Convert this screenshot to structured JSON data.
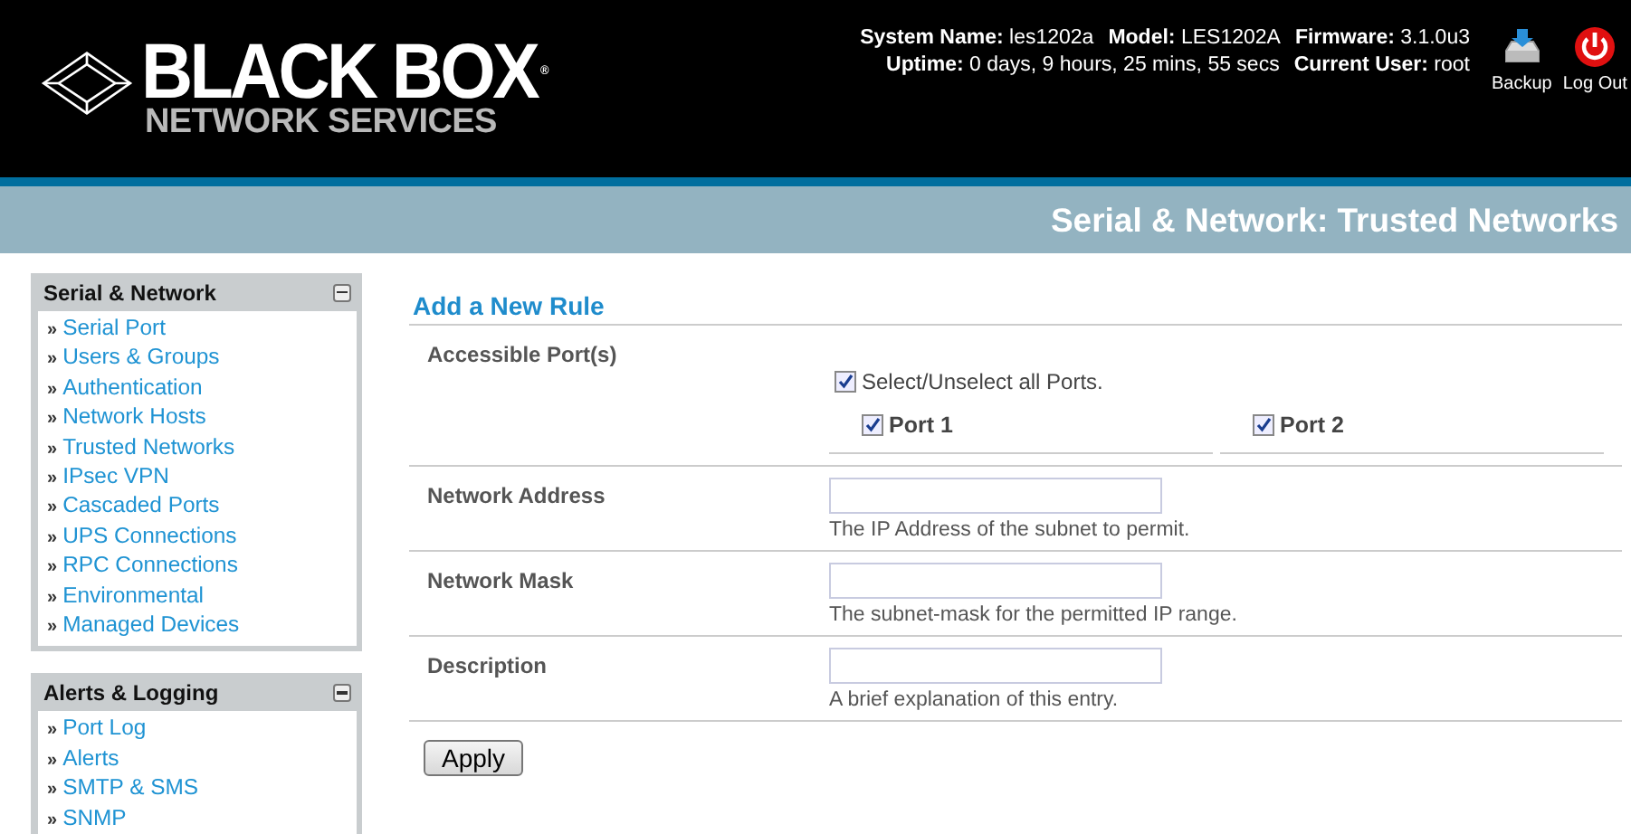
{
  "header": {
    "logo": {
      "title": "BLACK BOX",
      "registered": "®",
      "subtitle": "NETWORK SERVICES"
    },
    "info_lines": [
      [
        "**System Name:** les1202a",
        "**Model:** LES1202A",
        "**Firmware:** 3.1.0u3"
      ],
      [
        "**Uptime:** 0 days, 9 hours, 25 mins, 55 secs",
        "**Current User:** root"
      ]
    ],
    "actions": [
      {
        "kind": "backup",
        "label": "Backup"
      },
      {
        "kind": "logout",
        "label": "Log Out"
      }
    ]
  },
  "page_title": "Serial & Network: Trusted Networks",
  "sidebar": [
    {
      "title": "Serial & Network",
      "expanded": true,
      "items": [
        {
          "marker": "»",
          "label": "Serial Port"
        },
        {
          "marker": "»",
          "label": "Users & Groups"
        },
        {
          "marker": "»",
          "label": "Authentication"
        },
        {
          "marker": "»",
          "label": "Network Hosts"
        },
        {
          "marker": "»",
          "label": "Trusted Networks"
        },
        {
          "marker": "»",
          "label": "IPsec VPN"
        },
        {
          "marker": "»",
          "label": "Cascaded Ports"
        },
        {
          "marker": "»",
          "label": "UPS Connections"
        },
        {
          "marker": "»",
          "label": "RPC Connections"
        },
        {
          "marker": "»",
          "label": "Environmental"
        },
        {
          "marker": "»",
          "label": "Managed Devices"
        }
      ]
    },
    {
      "title": "Alerts & Logging",
      "expanded": true,
      "items": [
        {
          "marker": "»",
          "label": "Port Log"
        },
        {
          "marker": "»",
          "label": "Alerts"
        },
        {
          "marker": "»",
          "label": "SMTP & SMS"
        },
        {
          "marker": "»",
          "label": "SNMP"
        }
      ]
    }
  ],
  "form": {
    "title": "Add a New Rule",
    "rows": [
      {
        "kind": "ports",
        "label": "Accessible Port(s)",
        "select_all": {
          "label": "Select/Unselect all Ports.",
          "checked": true
        },
        "ports": [
          {
            "label": "Port 1",
            "checked": true
          },
          {
            "label": "Port 2",
            "checked": true
          }
        ]
      },
      {
        "kind": "text",
        "label": "Network Address",
        "help": "The IP Address of the subnet to permit."
      },
      {
        "kind": "text",
        "label": "Network Mask",
        "help": "The subnet-mask for the permitted IP range."
      },
      {
        "kind": "text",
        "label": "Description",
        "help": "A brief explanation of this entry."
      }
    ],
    "submit": "Apply"
  }
}
